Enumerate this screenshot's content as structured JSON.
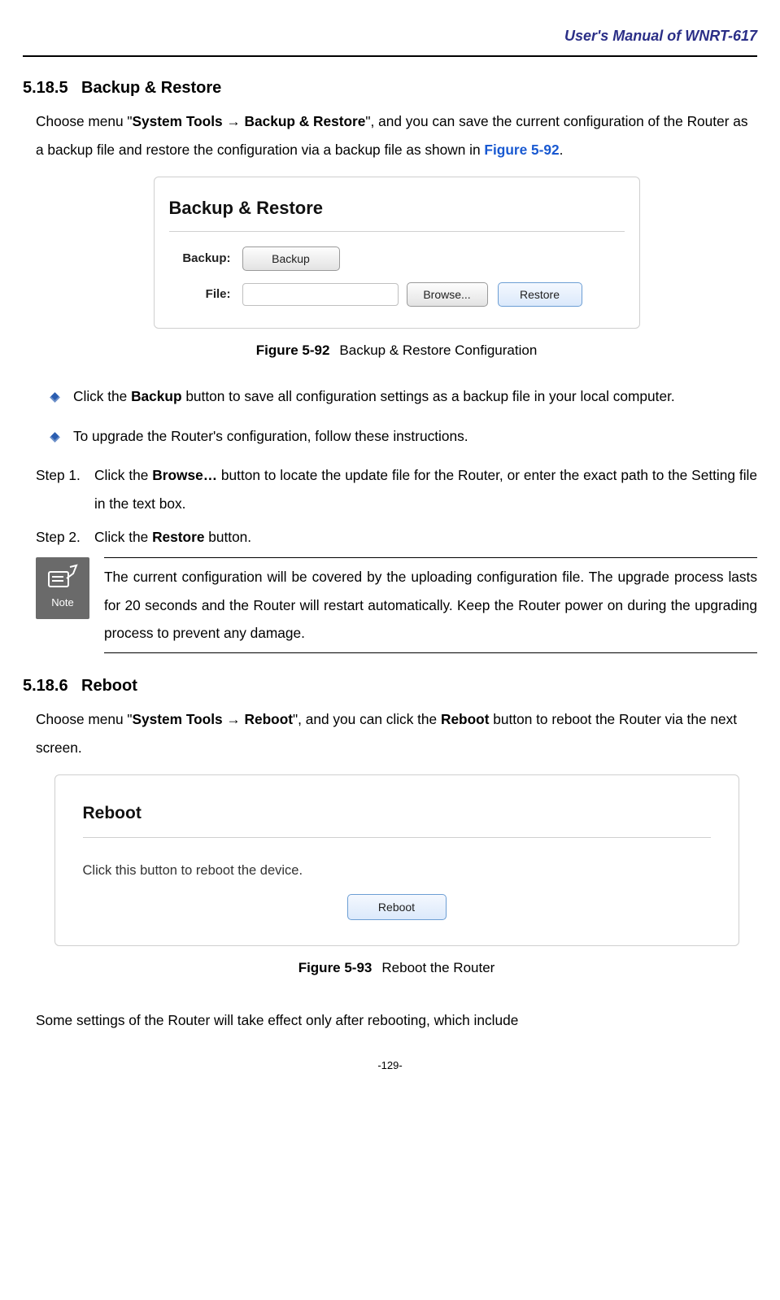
{
  "header": {
    "title": "User's  Manual  of  WNRT-617"
  },
  "section1": {
    "num": "5.18.5",
    "title": "Backup & Restore",
    "intro_pre": "Choose menu \"",
    "intro_b1": "System Tools",
    "intro_arrow": "  →  ",
    "intro_b2": "Backup & Restore",
    "intro_post1": "\", and you can save the current configuration of the Router as a backup file and restore the configuration via a backup file as shown in ",
    "intro_figref": "Figure 5-92",
    "intro_post2": "."
  },
  "fig92": {
    "panel_title": "Backup & Restore",
    "label_backup": "Backup:",
    "btn_backup": "Backup",
    "label_file": "File:",
    "btn_browse": "Browse...",
    "btn_restore": "Restore",
    "caption_b": "Figure 5-92",
    "caption_t": "Backup & Restore Configuration"
  },
  "bullets": {
    "b1_a": "Click the ",
    "b1_bold": "Backup",
    "b1_b": " button to save all configuration settings as a backup file in your local computer.",
    "b2": "To upgrade the Router's configuration, follow these instructions."
  },
  "steps": {
    "s1_label": "Step 1.",
    "s1_a": "Click the ",
    "s1_bold": "Browse…",
    "s1_b": " button to locate the update file for the Router, or enter the exact path to the Setting file in the text box.",
    "s2_label": "Step 2.",
    "s2_a": "Click the ",
    "s2_bold": "Restore",
    "s2_b": " button."
  },
  "note": {
    "label": "Note",
    "text": "The current configuration will be covered by the uploading configuration file. The upgrade process lasts for 20 seconds and the Router will restart automatically. Keep the Router power on during the upgrading process to prevent any damage."
  },
  "section2": {
    "num": "5.18.6",
    "title": "Reboot",
    "intro_pre": "Choose menu \"",
    "intro_b1": "System Tools",
    "intro_arrow": "  →  ",
    "intro_b2": "Reboot",
    "intro_post1": "\", and you can click the ",
    "intro_b3": "Reboot",
    "intro_post2": " button to reboot the Router via the next screen."
  },
  "fig93": {
    "panel_title": "Reboot",
    "msg": "Click this button to reboot the device.",
    "btn": "Reboot",
    "caption_b": "Figure 5-93",
    "caption_t": "Reboot the Router"
  },
  "trailing": "Some settings of the Router will take effect only after rebooting, which include",
  "page_num": "-129-"
}
